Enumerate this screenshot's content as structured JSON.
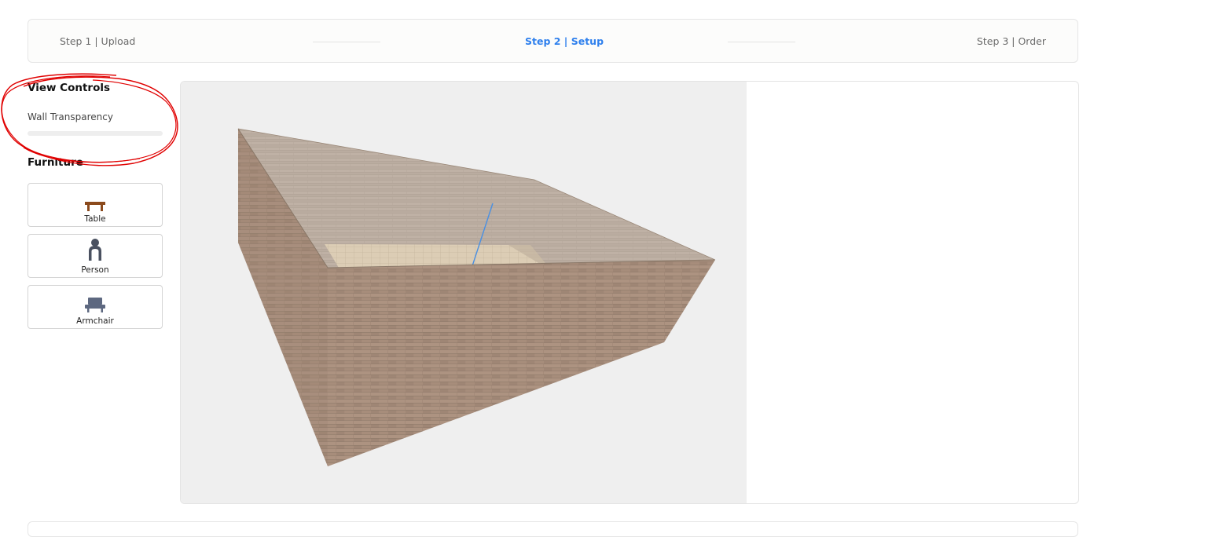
{
  "stepper": {
    "steps": [
      {
        "label": "Step 1 | Upload",
        "active": false
      },
      {
        "label": "Step 2 | Setup",
        "active": true
      },
      {
        "label": "Step 3 | Order",
        "active": false
      }
    ]
  },
  "sidebar": {
    "view_controls_title": "View Controls",
    "wall_transparency_label": "Wall Transparency",
    "wall_transparency_value": 0,
    "furniture_title": "Furniture",
    "furniture": [
      {
        "label": "Table",
        "icon": "table-icon"
      },
      {
        "label": "Person",
        "icon": "person-icon"
      },
      {
        "label": "Armchair",
        "icon": "armchair-icon"
      }
    ]
  },
  "viewer": {
    "scene": "3d-room-brick-walls"
  },
  "colors": {
    "accent": "#2f80ed",
    "annotation": "#e00000",
    "table": "#8b4a1c",
    "person": "#4a5160",
    "armchair": "#5d6880"
  }
}
